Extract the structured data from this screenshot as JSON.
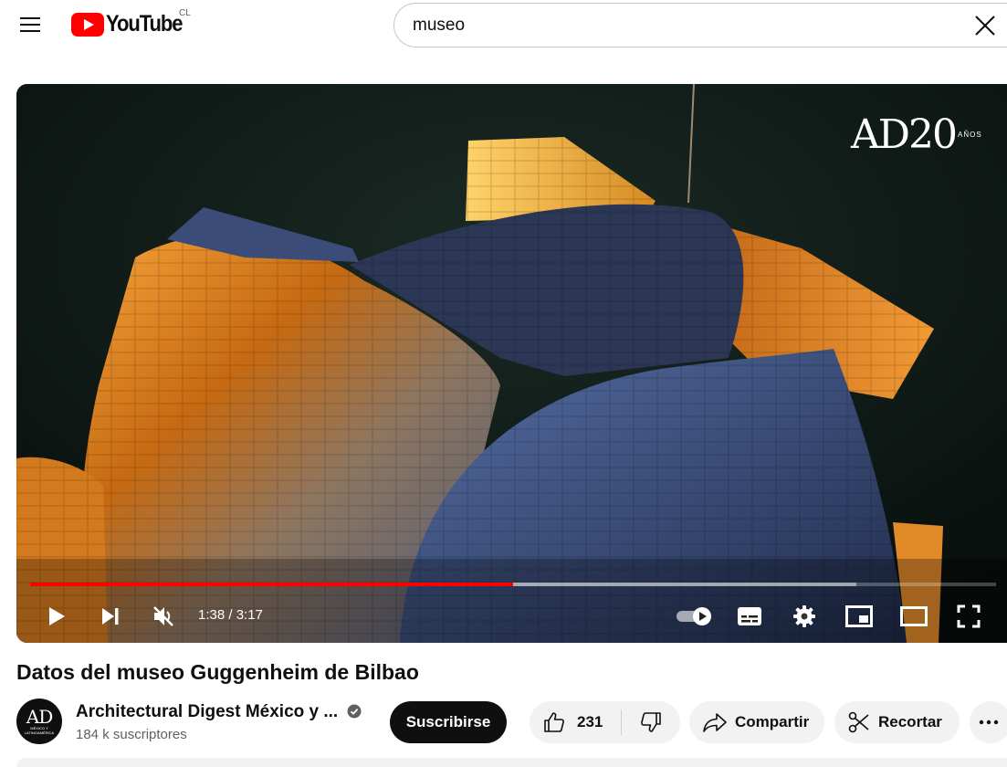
{
  "header": {
    "logo_text": "YouTube",
    "country_code": "CL",
    "search_value": "museo"
  },
  "player": {
    "overlay_logo": "AD20",
    "overlay_logo_small": "AÑOS",
    "current_time": "1:38",
    "duration": "3:17",
    "time_display": "1:38 / 3:17",
    "played_fraction": 0.5,
    "buffered_fraction": 0.855,
    "muted": true,
    "autoplay_on": true
  },
  "video": {
    "title": "Datos del museo Guggenheim de Bilbao"
  },
  "channel": {
    "name": "Architectural Digest México y ...",
    "subscribers": "184 k suscriptores",
    "avatar_text": "AD",
    "avatar_subtext": "MÉXICO Y LATINOAMÉRICA",
    "verified": true
  },
  "actions": {
    "subscribe_label": "Suscribirse",
    "like_count": "231",
    "share_label": "Compartir",
    "clip_label": "Recortar"
  },
  "colors": {
    "brand_red": "#ff0000",
    "text_primary": "#0f0f0f",
    "text_secondary": "#606060",
    "pill_bg": "#f2f2f2"
  }
}
